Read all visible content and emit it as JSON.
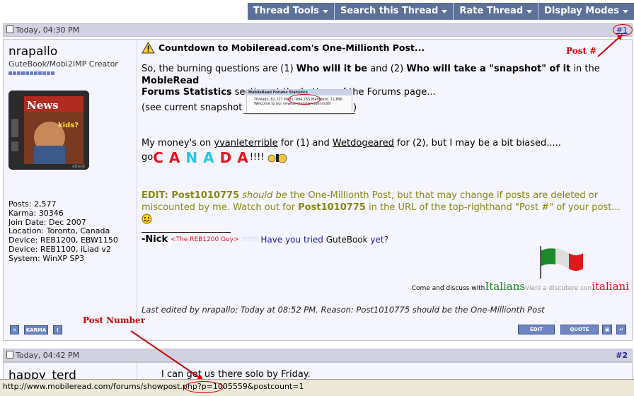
{
  "toolbar": {
    "items": [
      {
        "label": "Thread Tools"
      },
      {
        "label": "Search this Thread"
      },
      {
        "label": "Rate Thread"
      },
      {
        "label": "Display Modes"
      }
    ]
  },
  "post1": {
    "date": "Today, 04:30 PM",
    "number": "#1",
    "username": "nrapallo",
    "user_title": "GuteBook/Mobi2IMP Creator",
    "stats": [
      "Posts: 2,577",
      "Karma: 30346",
      "Join Date: Dec 2007",
      "Location: Toronto, Canada",
      "Device: REB1200, EBW1150",
      "Device: REB1100, iLiad v2",
      "System: WinXP SP3"
    ],
    "title": "Countdown to Mobileread.com's One-Millionth Post...",
    "p1": {
      "a": "So, the burning questions are (1) ",
      "b": "Who will it be",
      "c": " and (2) ",
      "d": "Who will take a \"snapshot\" of it",
      "e": " in the ",
      "f": "MobleRead",
      "g": "Forums Statistics",
      "h": " section at the bottom of the Forums page..."
    },
    "snapshot": {
      "prefix": "(see current snapshot ",
      "suffix": " )",
      "header": "MobileRead Forums Statistics",
      "line1": "Threads: 82,727  Posts: 994,755  Members: 72,896",
      "line2": "Welcome to our newest member, johnny99"
    },
    "money": {
      "a": "My money's on ",
      "b": "yvanleterrible",
      "c": " for (1) and ",
      "d": "Wetdogeared",
      "e": " for (2), but I may be a bit biased....."
    },
    "go": "go ",
    "canada_letters": [
      "C",
      "A",
      "N",
      "A",
      "D",
      "A"
    ],
    "canada_colors": [
      "#e8141c",
      "#e8141c",
      "#22c8e8",
      "#22c8e8",
      "#e8141c",
      "#e8141c"
    ],
    "exclaim": "!!!!",
    "edit": {
      "a": "EDIT: ",
      "b": "Post1010775",
      "c": " should be",
      "d": " the One-Millionth Post, but that may change if posts are deleted or",
      "e": "miscounted by me. Watch out for ",
      "f": "Post1010775",
      "g": " in the URL of the top-righthand \"Post #\" of your post..."
    },
    "sig": {
      "name": "-Nick",
      "reb": "<The REB1200 Guy>",
      "q1": "Have you tried ",
      "q2": "GuteBook",
      "q3": " yet?",
      "come": "Come and discuss with ",
      "italians": "Italians",
      "vieni": " Vieni a discutere con ",
      "italiani": "italiani"
    },
    "last_edited": "Last edited by nrapallo; Today at 08:52 PM. Reason: Post1010775 should be the One-Millionth Post",
    "footer_left": [
      "KARMA"
    ],
    "footer_right": [
      "EDIT",
      "QUOTE"
    ]
  },
  "post2": {
    "date": "Today, 04:42 PM",
    "number": "#2",
    "username": "happy_terd",
    "text": "I can get us there solo by Friday."
  },
  "annotations": {
    "post_hash": "Post #",
    "post_number": "Post Number"
  },
  "status_bar": {
    "url_prefix": "http://www.mobileread.com/forums/showpost.php?p=",
    "url_postid": "1005559",
    "url_suffix": "&postcount=1"
  },
  "colors": {
    "toolbar": "#5c7099",
    "post_header": "#d1d1e1",
    "olive_text": "#878712",
    "annotation": "#cc0000"
  }
}
